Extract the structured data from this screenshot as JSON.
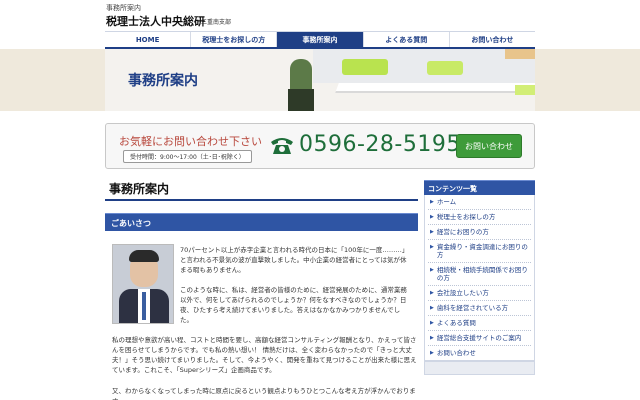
{
  "header": {
    "caption": "事務所案内",
    "title": "税理士法人中央総研",
    "branch": "三重南支部"
  },
  "nav": {
    "items": [
      {
        "label": "HOME"
      },
      {
        "label": "税理士をお探しの方"
      },
      {
        "label": "事務所案内"
      },
      {
        "label": "よくある質問"
      },
      {
        "label": "お問い合わせ"
      }
    ],
    "active": "事務所案内"
  },
  "banner": {
    "title": "事務所案内"
  },
  "contact": {
    "lead": "お気軽にお問い合わせ下さい",
    "hours": "受付時間：9:00～17:00（土･日･祝除く）",
    "phone": "0596-28-5195",
    "button": "お問い合わせ"
  },
  "main": {
    "heading": "事務所案内",
    "section": "ごあいさつ",
    "paragraphs": [
      "70パーセント以上が赤字企業と言われる時代の日本に「100年に一度………」と言われる不景気の波が直撃致しました。中小企業の経営者にとっては気が休まる暇もありません。",
      "このような時に、私は、経営者の皆様のために、経営発展のために、通常業務以外で、何をしてあげられるのでしょうか？何をなすべきなのでしょうか？日夜、ひたすら考え続けてまいりました。答えはなかなかみつかりませんでした。",
      "私の理想や意欲が高い程、コストと時間を要し、高額な経営コンサルティング報酬となり、かえって皆さんを困らせてしまうからです。でも私の熱い想い！ 情熱だけは、全く変わらなかったので「きっと大丈夫！」そう思い続けてまいりました。そして、今ようやく、開発を重ねて見つけることが出来た様に思えています。これこそ、「Superシリーズ」企画商品です。",
      "又、わからなくなってしまった時に原点に戻るという観点よりもうひとつこんな考え方が浮かんでおります。"
    ]
  },
  "sidebar": {
    "title": "コンテンツ一覧",
    "items": [
      {
        "label": "ホーム"
      },
      {
        "label": "税理士をお探しの方"
      },
      {
        "label": "経営にお困りの方"
      },
      {
        "label": "資金繰り・資金調達にお困りの方"
      },
      {
        "label": "相続税・相続手続関係でお困りの方"
      },
      {
        "label": "会社設立したい方"
      },
      {
        "label": "歯科を経営されている方"
      },
      {
        "label": "よくある質問"
      },
      {
        "label": "経営総合支援サイトのご案内"
      },
      {
        "label": "お問い合わせ"
      }
    ]
  },
  "colors": {
    "brand_navy": "#1f3f86",
    "section_blue": "#2f55a4",
    "phone_green": "#1e6e3a",
    "lead_red": "#b8473c"
  }
}
